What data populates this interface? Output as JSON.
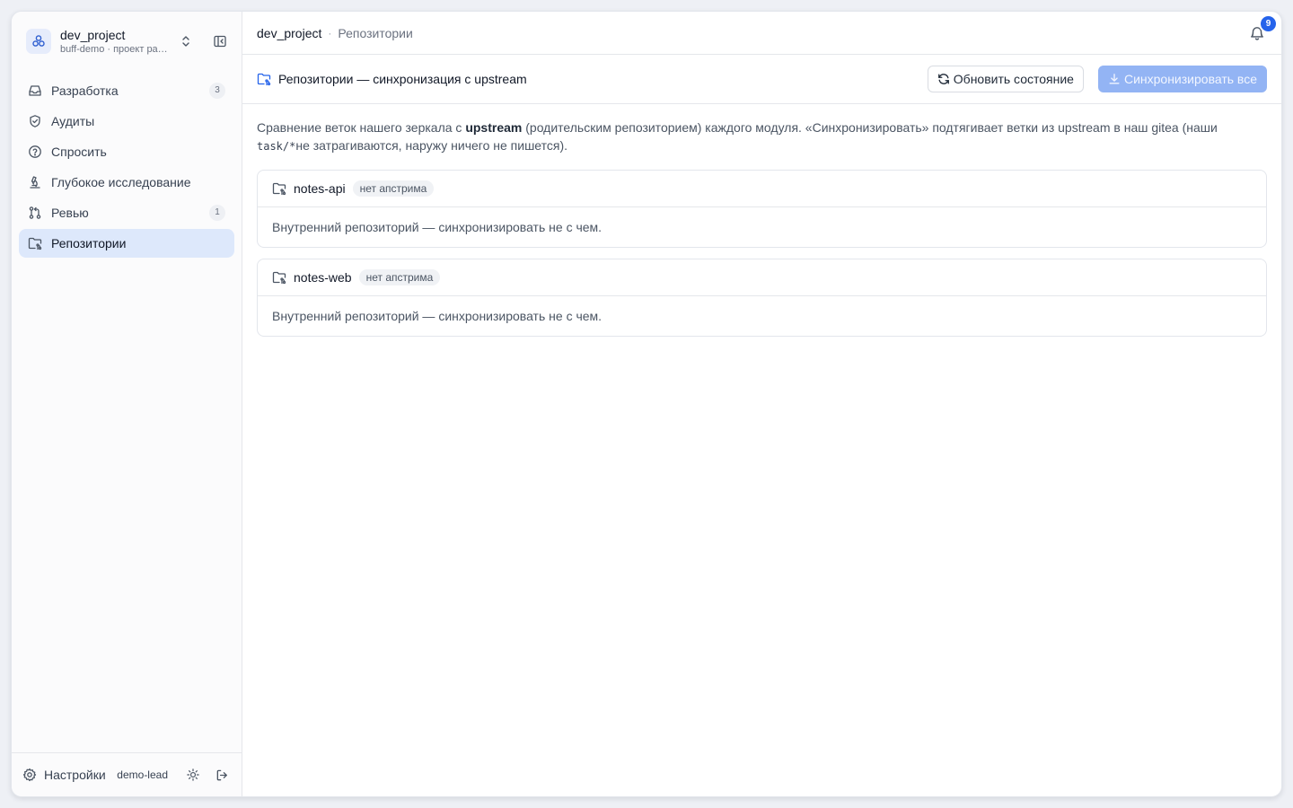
{
  "project": {
    "name": "dev_project",
    "subtitle": "buff-demo · проект разр..."
  },
  "sidebar": {
    "items": [
      {
        "label": "Разработка",
        "icon": "inbox-icon",
        "count": "3",
        "active": false
      },
      {
        "label": "Аудиты",
        "icon": "shield-check-icon",
        "count": "",
        "active": false
      },
      {
        "label": "Спросить",
        "icon": "help-circle-icon",
        "count": "",
        "active": false
      },
      {
        "label": "Глубокое исследование",
        "icon": "microscope-icon",
        "count": "",
        "active": false
      },
      {
        "label": "Ревью",
        "icon": "git-pull-request-icon",
        "count": "1",
        "active": false
      },
      {
        "label": "Репозитории",
        "icon": "folder-git-icon",
        "count": "",
        "active": true
      }
    ],
    "footer": {
      "settings_label": "Настройки",
      "user": "demo-lead"
    }
  },
  "topbar": {
    "breadcrumb_project": "dev_project",
    "breadcrumb_sep": "·",
    "breadcrumb_page": "Репозитории",
    "notifications_count": "9"
  },
  "pagebar": {
    "title": "Репозитории — синхронизация с upstream",
    "refresh_label": "Обновить состояние",
    "sync_all_label": "Синхронизировать все"
  },
  "intro": {
    "part1": "Сравнение веток нашего зеркала с ",
    "bold": "upstream",
    "part2": " (родительским репозиторием) каждого модуля. «Синхронизировать» подтягивает ветки из upstream в наш gitea (наши ",
    "code": "task/*",
    "part3": "не затрагиваются, наружу ничего не пишется)."
  },
  "repos": [
    {
      "name": "notes-api",
      "tag": "нет апстрима",
      "message": "Внутренний репозиторий — синхронизировать не с чем."
    },
    {
      "name": "notes-web",
      "tag": "нет апстрима",
      "message": "Внутренний репозиторий — синхронизировать не с чем."
    }
  ],
  "colors": {
    "accent": "#2563eb",
    "active_nav_bg": "#dde8fb",
    "primary_disabled": "#93b4f4"
  }
}
